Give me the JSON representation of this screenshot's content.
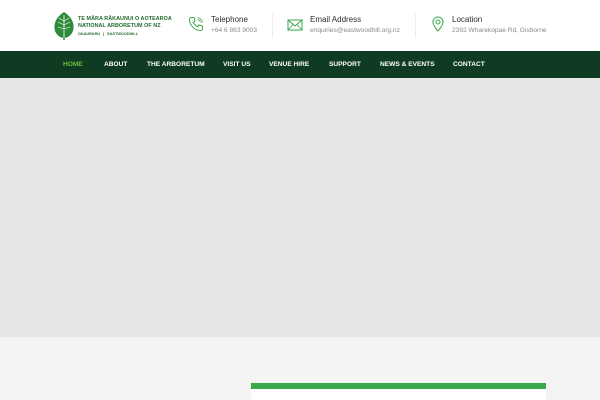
{
  "logo": {
    "line1": "TE MĀRA RĀKAUNUI O AOTEAROA",
    "line2": "NATIONAL ARBORETUM OF NZ",
    "line3a": "OKAURARU",
    "line3b": "EASTWOODHILL",
    "icon": "leaf-icon"
  },
  "contacts": {
    "telephone": {
      "label": "Telephone",
      "value": "+64 6 863 9003",
      "icon": "phone-icon"
    },
    "email": {
      "label": "Email Address",
      "value": "enquiries@eastwoodhill.org.nz",
      "icon": "envelope-icon"
    },
    "location": {
      "label": "Location",
      "value": "2392 Wharekopae Rd, Gisborne",
      "icon": "map-pin-icon"
    }
  },
  "nav": {
    "items": [
      {
        "label": "HOME",
        "active": true
      },
      {
        "label": "ABOUT"
      },
      {
        "label": "THE ARBORETUM"
      },
      {
        "label": "VISIT US"
      },
      {
        "label": "VENUE HIRE"
      },
      {
        "label": "SUPPORT"
      },
      {
        "label": "NEWS & EVENTS"
      },
      {
        "label": "CONTACT"
      }
    ]
  },
  "colors": {
    "nav_bg": "#0f3b22",
    "nav_active": "#6fbf3a",
    "accent": "#3aa84b",
    "brand_green": "#1f6b2c"
  }
}
